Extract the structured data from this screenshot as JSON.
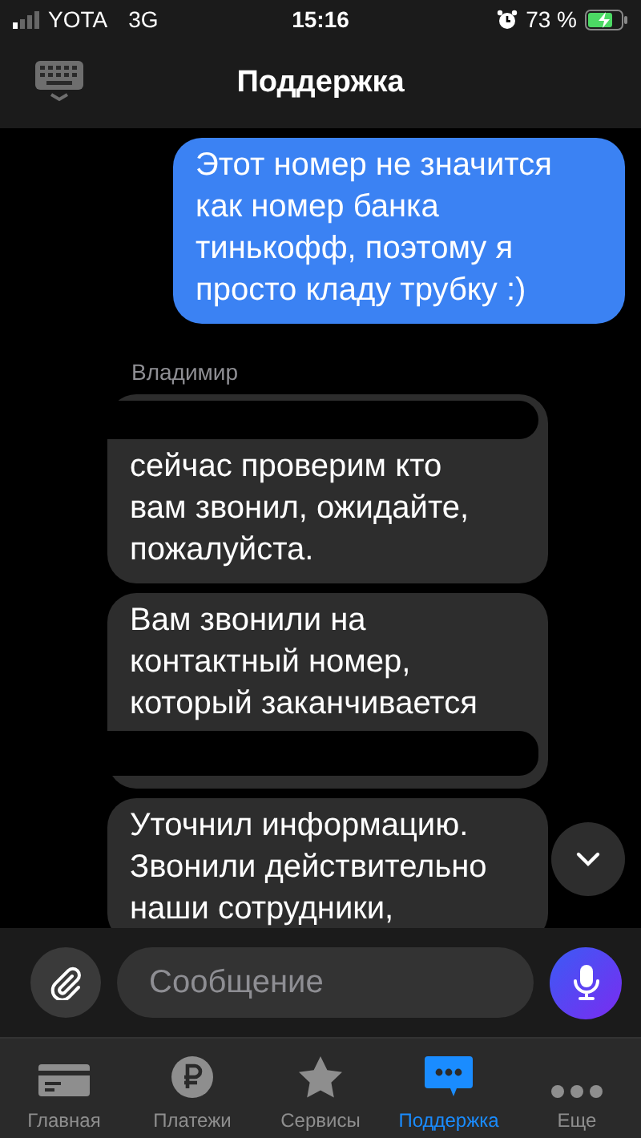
{
  "status_bar": {
    "carrier": "YOTA",
    "network": "3G",
    "time": "15:16",
    "battery": "73 %"
  },
  "header": {
    "title": "Поддержка"
  },
  "messages": [
    {
      "kind": "outgoing",
      "text": "Этот номер не значится как номер банка тинькофф, поэтому я просто кладу трубку :)"
    },
    {
      "kind": "sender",
      "text": "Владимир"
    },
    {
      "kind": "incoming",
      "text": "сейчас проверим кто вам звонил, ожидайте, пожалуйста."
    },
    {
      "kind": "incoming",
      "text": "Вам звонили на контактный номер, который заканчивается"
    },
    {
      "kind": "incoming",
      "text": "Уточнил информацию. Звонили действительно наши сотрудники,"
    }
  ],
  "composer": {
    "placeholder": "Сообщение"
  },
  "tabs": [
    {
      "label": "Главная",
      "selected": false
    },
    {
      "label": "Платежи",
      "selected": false
    },
    {
      "label": "Сервисы",
      "selected": false
    },
    {
      "label": "Поддержка",
      "selected": true
    },
    {
      "label": "Еще",
      "selected": false
    }
  ]
}
